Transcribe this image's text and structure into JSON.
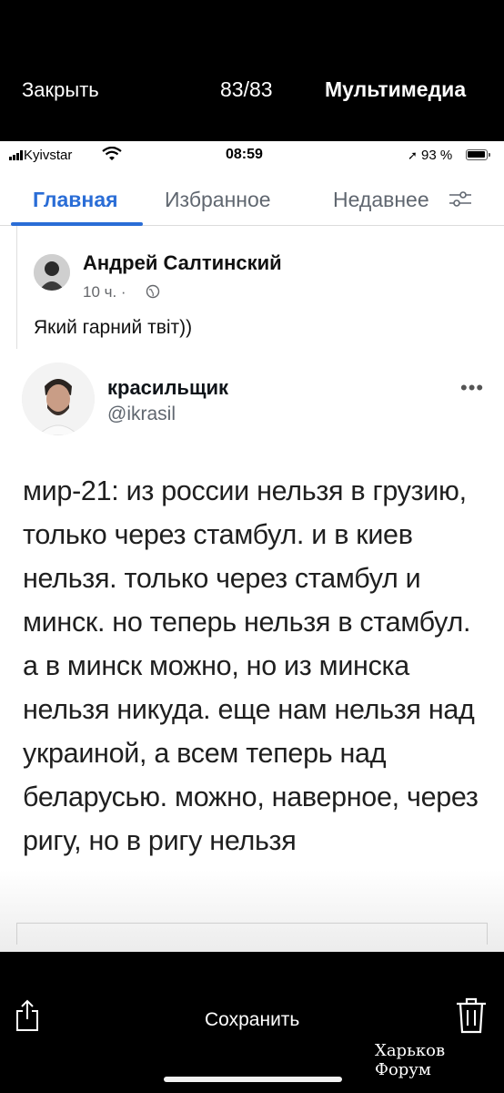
{
  "viewer": {
    "close_label": "Закрыть",
    "counter": "83/83",
    "media_label": "Мультимедиа"
  },
  "status_bar": {
    "carrier": "Kyivstar",
    "time": "08:59",
    "battery_percent": "93 %",
    "icons": [
      "signal-icon",
      "wifi-icon",
      "location-arrow-icon",
      "battery-icon"
    ]
  },
  "tabs": {
    "items": [
      {
        "label": "Главная",
        "active": true
      },
      {
        "label": "Избранное",
        "active": false
      },
      {
        "label": "Недавнее",
        "active": false
      }
    ],
    "filter_icon": "sliders-icon",
    "accent_color": "#2a6dd6"
  },
  "post": {
    "author": "Андрей Салтинский",
    "time": "10 ч. ·",
    "visibility_icon": "globe-icon",
    "text": "Який гарний твіт))"
  },
  "tweet": {
    "display_name": "красильщик",
    "handle": "@ikrasil",
    "more_icon": "more-dots-icon",
    "text": "мир-21: из россии нельзя в грузию, только через стамбул. и в киев нельзя. только через стамбул и минск. но теперь нельзя в стамбул. а в минск можно, но из минска нельзя никуда. еще нам нельзя над украиной, а всем теперь над беларусью. можно, наверное, через ригу, но в ригу нельзя"
  },
  "bottom_bar": {
    "share_icon": "share-icon",
    "save_label": "Сохранить",
    "trash_icon": "trash-icon",
    "watermark": "Харьков Форум"
  }
}
